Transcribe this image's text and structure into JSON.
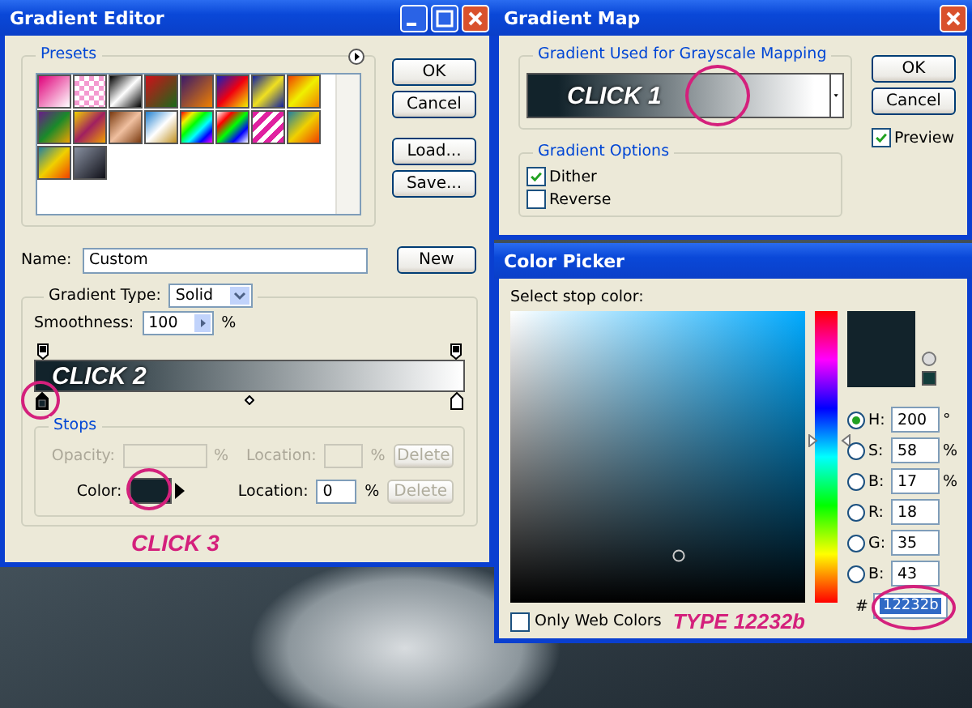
{
  "gradient_editor": {
    "title": "Gradient Editor",
    "presets_label": "Presets",
    "buttons": [
      "OK",
      "Cancel",
      "Load...",
      "Save..."
    ],
    "name_label": "Name:",
    "name_value": "Custom",
    "new_button": "New",
    "gradient_type_label": "Gradient Type:",
    "gradient_type": "Solid",
    "smoothness_label": "Smoothness:",
    "smoothness": "100",
    "smoothness_unit": "%",
    "gradient_note": "CLICK 2",
    "stops_label": "Stops",
    "stop_rows": [
      {
        "kind": "opacity",
        "label": "Opacity:",
        "unit": "%",
        "location_label": "Location:",
        "location_unit": "%",
        "delete": "Delete",
        "disabled": true,
        "delete_disabled": true
      },
      {
        "kind": "color",
        "label": "Color:",
        "location_label": "Location:",
        "location_value": "0",
        "location_unit": "%",
        "delete": "Delete",
        "disabled": false,
        "delete_disabled": true
      }
    ],
    "color_note": "CLICK 3"
  },
  "gradient_map": {
    "title": "Gradient Map",
    "group_label": "Gradient Used for Grayscale Mapping",
    "gradient_note": "CLICK 1",
    "buttons": [
      "OK",
      "Cancel"
    ],
    "preview": {
      "label": "Preview",
      "checked": true
    },
    "options_label": "Gradient Options",
    "options": [
      {
        "label": "Dither",
        "checked": true
      },
      {
        "label": "Reverse",
        "checked": false
      }
    ]
  },
  "color_picker": {
    "title": "Color Picker",
    "prompt": "Select stop color:",
    "fields": [
      {
        "label": "H:",
        "value": "200",
        "unit": "°",
        "selected": true
      },
      {
        "label": "S:",
        "value": "58",
        "unit": "%",
        "selected": false
      },
      {
        "label": "B:",
        "value": "17",
        "unit": "%",
        "selected": false
      },
      {
        "label": "R:",
        "value": "18",
        "selected": false
      },
      {
        "label": "G:",
        "value": "35",
        "selected": false
      },
      {
        "label": "B:",
        "value": "43",
        "selected": false
      }
    ],
    "hue": {
      "level": 0.556
    },
    "hex_label": "#",
    "hex_value": "12232b",
    "only_web_colors": {
      "label": "Only Web Colors",
      "checked": false
    },
    "type_note": "TYPE 12232b"
  }
}
